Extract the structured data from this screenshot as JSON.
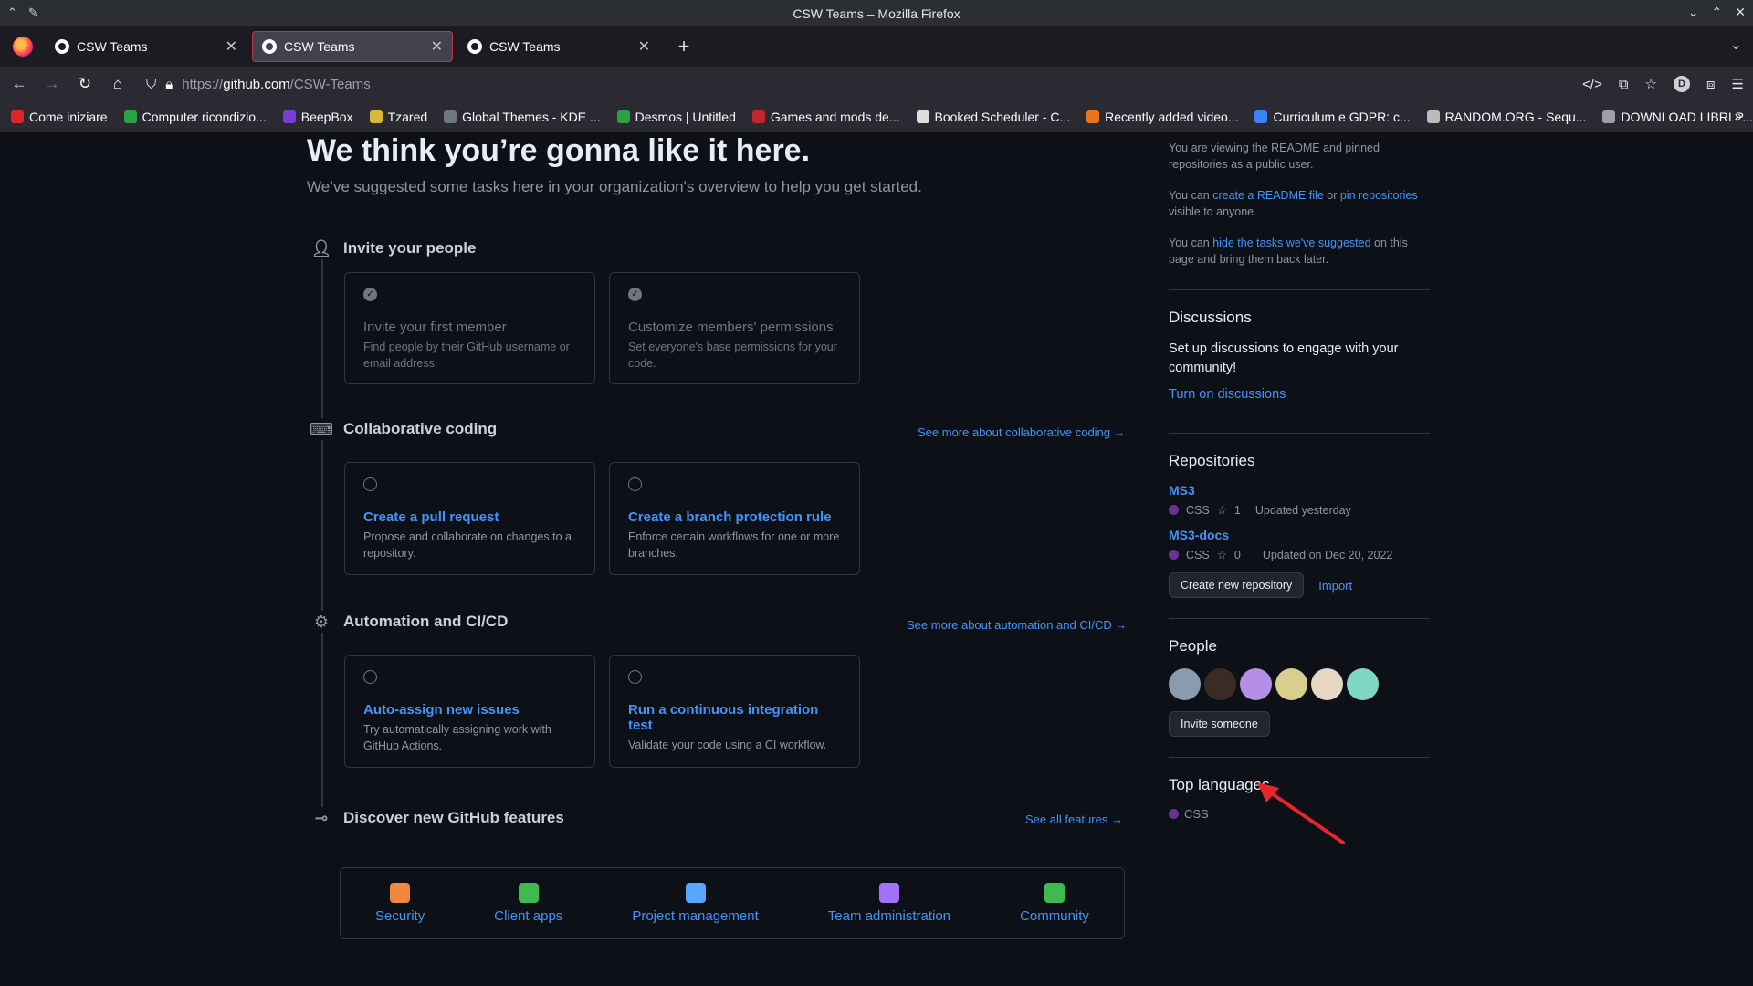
{
  "window": {
    "title": "CSW Teams – Mozilla Firefox"
  },
  "tabs": [
    {
      "label": "CSW Teams"
    },
    {
      "label": "CSW Teams"
    },
    {
      "label": "CSW Teams"
    }
  ],
  "navbar": {
    "url_prefix": "https://",
    "url_host": "github.com",
    "url_path": "/CSW-Teams"
  },
  "bookmarks": [
    {
      "label": "Come iniziare",
      "color": "#e0242b"
    },
    {
      "label": "Computer ricondizio...",
      "color": "#2ea043"
    },
    {
      "label": "BeepBox",
      "color": "#7a3cd6"
    },
    {
      "label": "Tzared",
      "color": "#d6b83c"
    },
    {
      "label": "Global Themes - KDE ...",
      "color": "#6e7681"
    },
    {
      "label": "Desmos | Untitled",
      "color": "#2ea043"
    },
    {
      "label": "Games and mods de...",
      "color": "#c1272d"
    },
    {
      "label": "Booked Scheduler - C...",
      "color": "#dddddd"
    },
    {
      "label": "Recently added video...",
      "color": "#e8741c"
    },
    {
      "label": "Curriculum e GDPR: c...",
      "color": "#3b82f6"
    },
    {
      "label": "RANDOM.ORG - Sequ...",
      "color": "#bbbbbb"
    },
    {
      "label": "DOWNLOAD LIBRI P...",
      "color": "#9e9ea6"
    }
  ],
  "main": {
    "title": "We think you’re gonna like it here.",
    "subtitle": "We’ve suggested some tasks here in your organization's overview to help you get started.",
    "sections": {
      "invite": {
        "heading": "Invite your people",
        "cards": [
          {
            "title": "Invite your first member",
            "desc": "Find people by their GitHub username or email address."
          },
          {
            "title": "Customize members' permissions",
            "desc": "Set everyone's base permissions for your code."
          }
        ]
      },
      "coding": {
        "heading": "Collaborative coding",
        "see_more": "See more about collaborative coding",
        "cards": [
          {
            "title": "Create a pull request",
            "desc": "Propose and collaborate on changes to a repository."
          },
          {
            "title": "Create a branch protection rule",
            "desc": "Enforce certain workflows for one or more branches."
          }
        ]
      },
      "automation": {
        "heading": "Automation and CI/CD",
        "see_more": "See more about automation and CI/CD",
        "cards": [
          {
            "title": "Auto-assign new issues",
            "desc": "Try automatically assigning work with GitHub Actions."
          },
          {
            "title": "Run a continuous integration test",
            "desc": "Validate your code using a CI workflow."
          }
        ]
      },
      "discover": {
        "heading": "Discover new GitHub features",
        "see_more": "See all features",
        "features": [
          {
            "label": "Security",
            "icon": "shield-icon",
            "color": "#f0883e"
          },
          {
            "label": "Client apps",
            "icon": "apps-icon",
            "color": "#3fb950"
          },
          {
            "label": "Project management",
            "icon": "project-icon",
            "color": "#58a6ff"
          },
          {
            "label": "Team administration",
            "icon": "team-icon",
            "color": "#a371f7"
          },
          {
            "label": "Community",
            "icon": "globe-icon",
            "color": "#3fb950"
          }
        ]
      }
    }
  },
  "sidebar": {
    "readme_note": "You are viewing the README and pinned repositories as a public user.",
    "readme_prefix": "You can ",
    "readme_link1": "create a README file",
    "readme_or": " or ",
    "readme_link2": "pin repositories",
    "readme_suffix": " visible to anyone.",
    "hide_prefix": "You can ",
    "hide_link": "hide the tasks we've suggested",
    "hide_suffix": " on this page and bring them back later.",
    "discussions": {
      "heading": "Discussions",
      "text": "Set up discussions to engage with your community!",
      "link": "Turn on discussions"
    },
    "repositories": {
      "heading": "Repositories",
      "items": [
        {
          "name": "MS3",
          "lang": "CSS",
          "stars": "1",
          "updated": "Updated yesterday"
        },
        {
          "name": "MS3-docs",
          "lang": "CSS",
          "stars": "0",
          "updated": "Updated on Dec 20, 2022"
        }
      ],
      "new_button": "Create new repository",
      "import_link": "Import"
    },
    "people": {
      "heading": "People",
      "avatars": [
        "#8a9bb0",
        "#3a2b25",
        "#b58ee6",
        "#d8cf8e",
        "#e8d6c4",
        "#7fd6c2"
      ],
      "invite_button": "Invite someone"
    },
    "languages": {
      "heading": "Top languages",
      "items": [
        {
          "name": "CSS",
          "color": "#663399"
        }
      ]
    }
  }
}
